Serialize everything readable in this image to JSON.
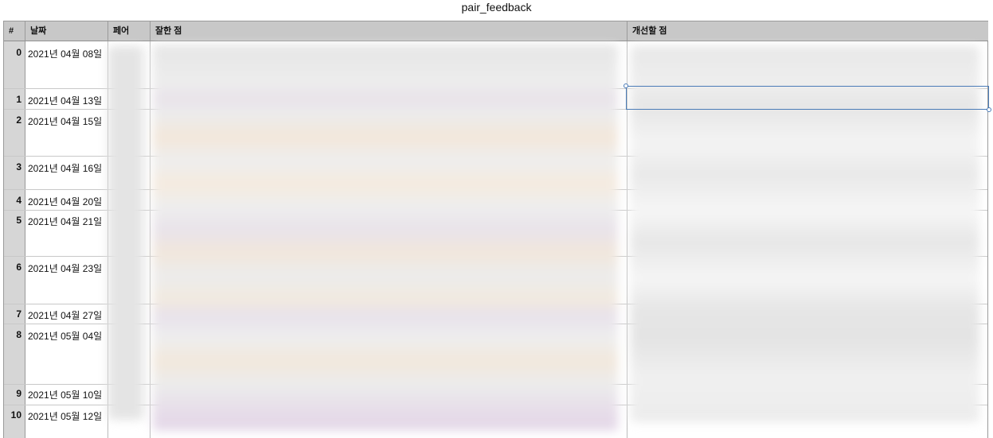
{
  "title": "pair_feedback",
  "columns": {
    "num": "#",
    "date": "날짜",
    "pair": "페어",
    "good": "잘한 점",
    "improve": "개선할 점"
  },
  "rows": [
    {
      "num": "0",
      "date": "2021년 04월 08일"
    },
    {
      "num": "1",
      "date": "2021년 04월 13일"
    },
    {
      "num": "2",
      "date": "2021년 04월 15일"
    },
    {
      "num": "3",
      "date": "2021년 04월 16일"
    },
    {
      "num": "4",
      "date": "2021년 04월 20일"
    },
    {
      "num": "5",
      "date": "2021년 04월 21일"
    },
    {
      "num": "6",
      "date": "2021년 04월 23일"
    },
    {
      "num": "7",
      "date": "2021년 04월 27일"
    },
    {
      "num": "8",
      "date": "2021년 05월 04일"
    },
    {
      "num": "9",
      "date": "2021년 05월 10일"
    },
    {
      "num": "10",
      "date": "2021년 05월 12일"
    }
  ]
}
